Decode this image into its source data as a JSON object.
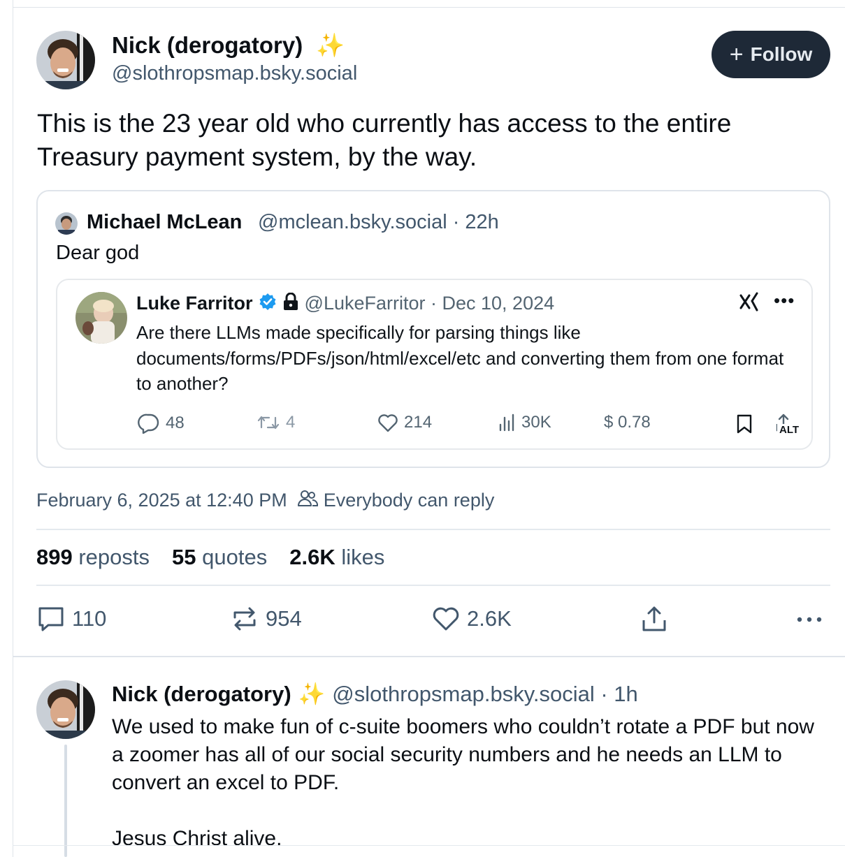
{
  "post": {
    "author_name": "Nick (derogatory)",
    "author_emoji": "✨",
    "author_handle": "@slothropsmap.bsky.social",
    "follow_label": "Follow",
    "text": "This is the 23 year old who currently has access to the entire Treasury payment system, by the way.",
    "timestamp": "February 6, 2025 at 12:40 PM",
    "reply_setting": "Everybody can reply",
    "stats": {
      "reposts_count": "899",
      "reposts_label": "reposts",
      "quotes_count": "55",
      "quotes_label": "quotes",
      "likes_count": "2.6K",
      "likes_label": "likes"
    },
    "actions": {
      "replies": "110",
      "reposts": "954",
      "likes": "2.6K"
    }
  },
  "quote": {
    "author_name": "Michael McLean",
    "meta": "@mclean.bsky.social · 22h",
    "text": "Dear god",
    "embed": {
      "author_name": "Luke Farritor",
      "meta": "@LukeFarritor · Dec 10, 2024",
      "text": "Are there LLMs made specifically for parsing things like documents/forms/PDFs/json/html/excel/etc and converting them from one format to another?",
      "replies": "48",
      "retweets": "4",
      "likes": "214",
      "views": "30K",
      "price": "$ 0.78",
      "alt_badge": "ALT"
    }
  },
  "reply": {
    "author_name": "Nick (derogatory)",
    "author_emoji": "✨",
    "meta": "@slothropsmap.bsky.social · 1h",
    "text": "We used to make fun of c-suite boomers who couldn’t rotate a PDF but now a zoomer has all of our social security numbers and he needs an LLM to convert an excel to PDF.",
    "text2": "Jesus Christ alive."
  },
  "colors": {
    "accent": "#1e2937",
    "muted": "#42576c",
    "verified": "#1d9bf0",
    "emoji": "#f5c518"
  }
}
